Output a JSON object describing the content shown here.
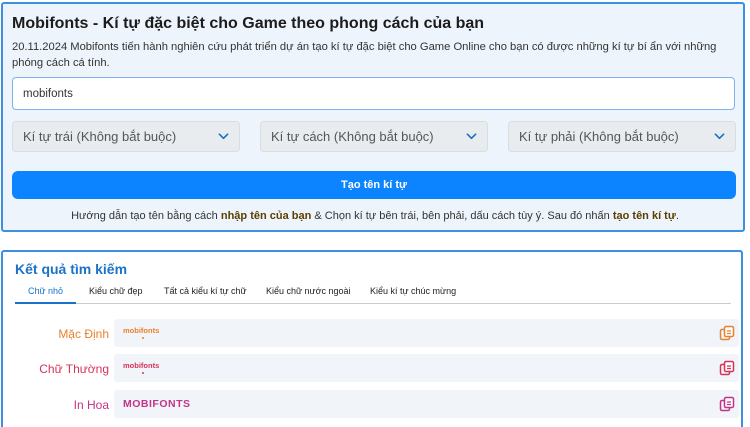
{
  "generator": {
    "title": "Mobifonts - Kí tự đặc biệt cho Game theo phong cách của bạn",
    "description": "20.11.2024 Mobifonts tiến hành nghiên cứu phát triển dự án tạo kí tự đặc biệt cho Game Online cho bạn có được những kí tự bí ẩn với những phóng cách cá tính.",
    "name_input_value": "mobifonts",
    "selects": [
      {
        "label": "Kí tự trái (Không bắt buộc)",
        "icon": "chevron-down-icon"
      },
      {
        "label": "Kí tự cách (Không bắt buộc)",
        "icon": "chevron-down-icon"
      },
      {
        "label": "Kí tự phải (Không bắt buộc)",
        "icon": "chevron-down-icon"
      }
    ],
    "create_button": "Tạo tên kí tự",
    "guide": {
      "part1": "Hướng dẫn tạo tên bằng cách ",
      "bold1": "nhập tên của bạn",
      "part2": " & Chọn kí tự bên trái, bên phải, dấu cách tùy ý. Sau đó nhấn ",
      "bold2": "tạo tên kí tự",
      "part3": "."
    }
  },
  "results": {
    "title": "Kết quả tìm kiếm",
    "tabs": [
      "Chữ nhỏ",
      "Kiểu chữ đẹp",
      "Tất cả kiểu kí tự chữ",
      "Kiểu chữ nước ngoài",
      "Kiểu kí tự chúc mừng"
    ],
    "active_tab": 0,
    "rows": [
      {
        "label": "Mặc Định",
        "text": "mobifonts",
        "color": "#e8822e",
        "dot_color": "#e8822e",
        "icon": "copy-icon"
      },
      {
        "label": "Chữ Thường",
        "text": "mobifonts",
        "color": "#d63357",
        "dot_color": "#d63357",
        "icon": "copy-icon"
      },
      {
        "label": "In Hoa",
        "text": "MOBIFONTS",
        "color": "#c2338a",
        "dot_color": "",
        "icon": "copy-icon"
      }
    ]
  },
  "colors": {
    "accent": "#0d84ff",
    "border": "#3d8fe0",
    "results_title": "#1a73c8"
  }
}
